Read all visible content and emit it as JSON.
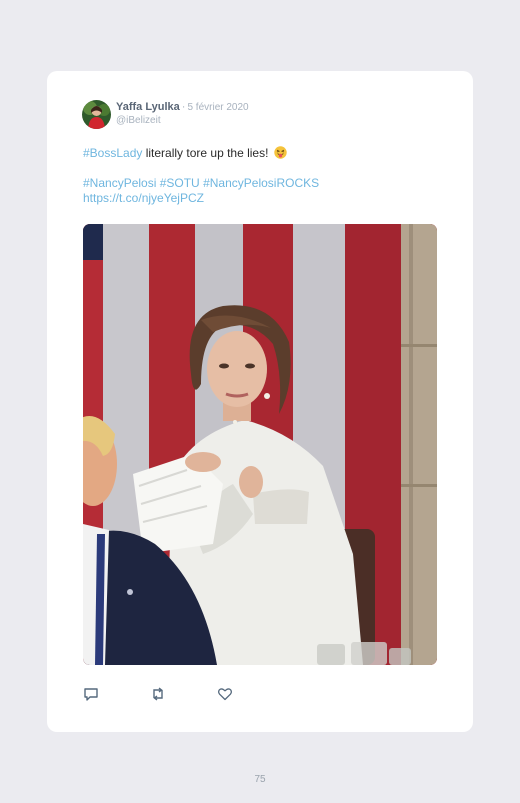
{
  "tweet": {
    "author_name": "Yaffa Lyulka",
    "separator": "·",
    "date": "5 février 2020",
    "handle": "@iBelizeit",
    "line1_hashtag": "#BossLady",
    "line1_text": " literally tore up the lies!",
    "line1_emoji": "face-with-tongue-emoji",
    "line2_tags": [
      "#NancyPelosi",
      "#SOTU",
      "#NancyPelosiROCKS"
    ],
    "line3_url": "https://t.co/njyeYejPCZ"
  },
  "actions": {
    "reply_icon": "reply-icon",
    "retweet_icon": "retweet-icon",
    "like_icon": "heart-icon"
  },
  "colors": {
    "link": "#6fb6df",
    "page_background": "#ebebf0",
    "card_background": "#ffffff"
  },
  "page": {
    "number": "75"
  }
}
